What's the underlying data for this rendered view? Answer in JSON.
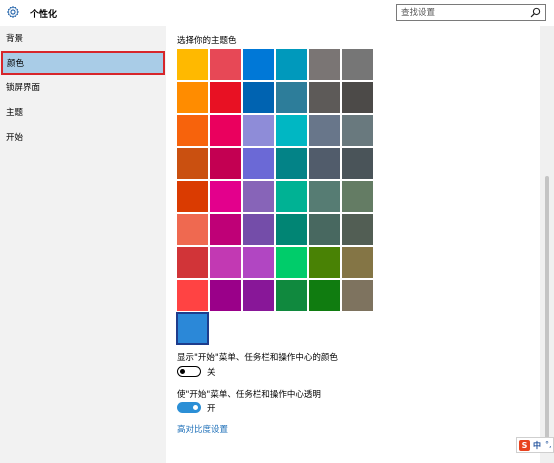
{
  "window": {
    "title": "个性化",
    "search": {
      "placeholder": "查找设置"
    }
  },
  "sidebar": {
    "items": [
      {
        "label": "背景",
        "selected": false
      },
      {
        "label": "颜色",
        "selected": true
      },
      {
        "label": "锁屏界面",
        "selected": false
      },
      {
        "label": "主题",
        "selected": false
      },
      {
        "label": "开始",
        "selected": false
      }
    ]
  },
  "main": {
    "section_title": "选择你的主题色",
    "swatches": [
      [
        "#FFB900",
        "#E74856",
        "#0078D7",
        "#0099BC",
        "#7A7574",
        "#767676"
      ],
      [
        "#FF8C00",
        "#E81123",
        "#0063B1",
        "#2D7D9A",
        "#5D5A58",
        "#4C4A48"
      ],
      [
        "#F7630C",
        "#EA005E",
        "#8E8CD8",
        "#00B7C3",
        "#68768A",
        "#69797E"
      ],
      [
        "#CA5010",
        "#C30052",
        "#6B69D6",
        "#038387",
        "#515C6B",
        "#4A5459"
      ],
      [
        "#DA3B01",
        "#E3008C",
        "#8764B8",
        "#00B294",
        "#567C73",
        "#647C64"
      ],
      [
        "#EF6950",
        "#BF0077",
        "#744DA9",
        "#018574",
        "#486860",
        "#525E54"
      ],
      [
        "#D13438",
        "#C239B3",
        "#B146C2",
        "#00CC6A",
        "#498205",
        "#847545"
      ],
      [
        "#FF4343",
        "#9A0089",
        "#881798",
        "#10893E",
        "#107C10",
        "#7E735F"
      ],
      [
        "#2B88D8"
      ]
    ],
    "selected_swatch": "#2B88D8",
    "option_start_color": {
      "label": "显示\"开始\"菜单、任务栏和操作中心的颜色",
      "state_label": "关",
      "on": false
    },
    "option_transparent": {
      "label": "使\"开始\"菜单、任务栏和操作中心透明",
      "state_label": "开",
      "on": true
    },
    "high_contrast_link": "高对比度设置"
  },
  "colors": {
    "accent": "#2B88D8",
    "sidebar_bg": "#F2F2F2",
    "selected_bg": "#A9CCE7",
    "selected_border": "#D7262B",
    "link": "#1D6FB8"
  },
  "tray": {
    "ime_label": "中"
  }
}
